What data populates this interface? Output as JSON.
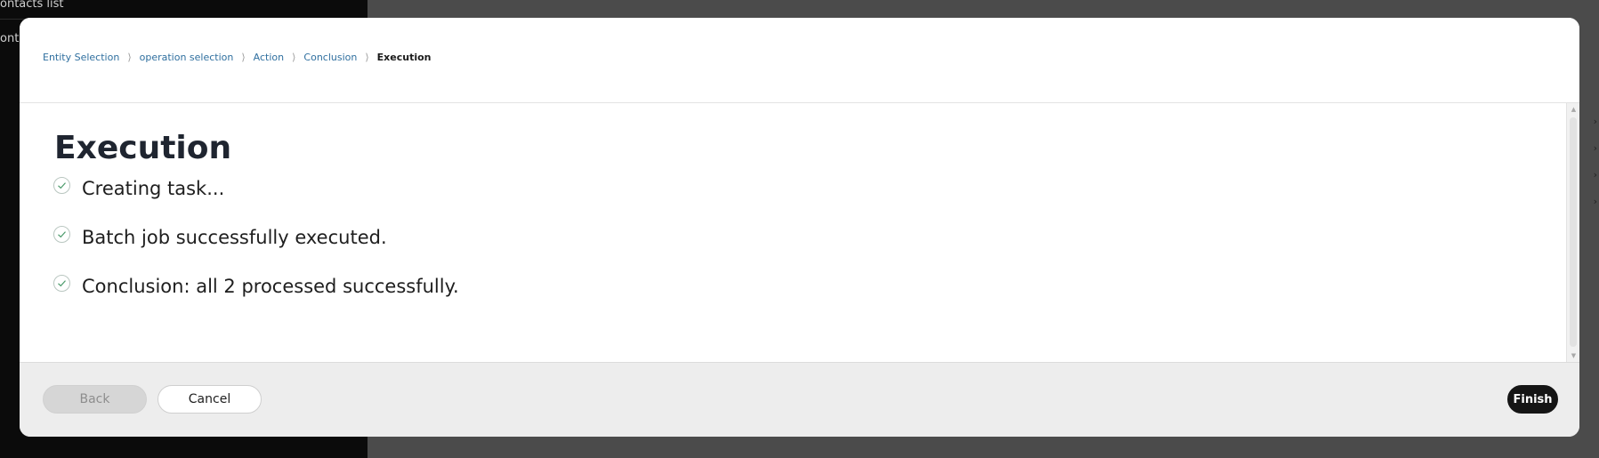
{
  "background": {
    "sidebar_item_1": "ontacts list",
    "sidebar_item_2": "ont"
  },
  "breadcrumb": {
    "items": [
      {
        "label": "Entity Selection"
      },
      {
        "label": "operation selection"
      },
      {
        "label": "Action"
      },
      {
        "label": "Conclusion"
      },
      {
        "label": "Execution"
      }
    ],
    "separator": "⟩"
  },
  "main": {
    "title": "Execution",
    "steps": [
      {
        "text": "Creating task...",
        "status": "done"
      },
      {
        "text": "Batch job successfully executed.",
        "status": "done"
      },
      {
        "text": "Conclusion: all 2 processed successfully.",
        "status": "done"
      }
    ]
  },
  "footer": {
    "back_label": "Back",
    "cancel_label": "Cancel",
    "finish_label": "Finish"
  },
  "colors": {
    "link": "#2f6f9f",
    "check": "#4a9a6a",
    "finish_bg": "#151515"
  }
}
